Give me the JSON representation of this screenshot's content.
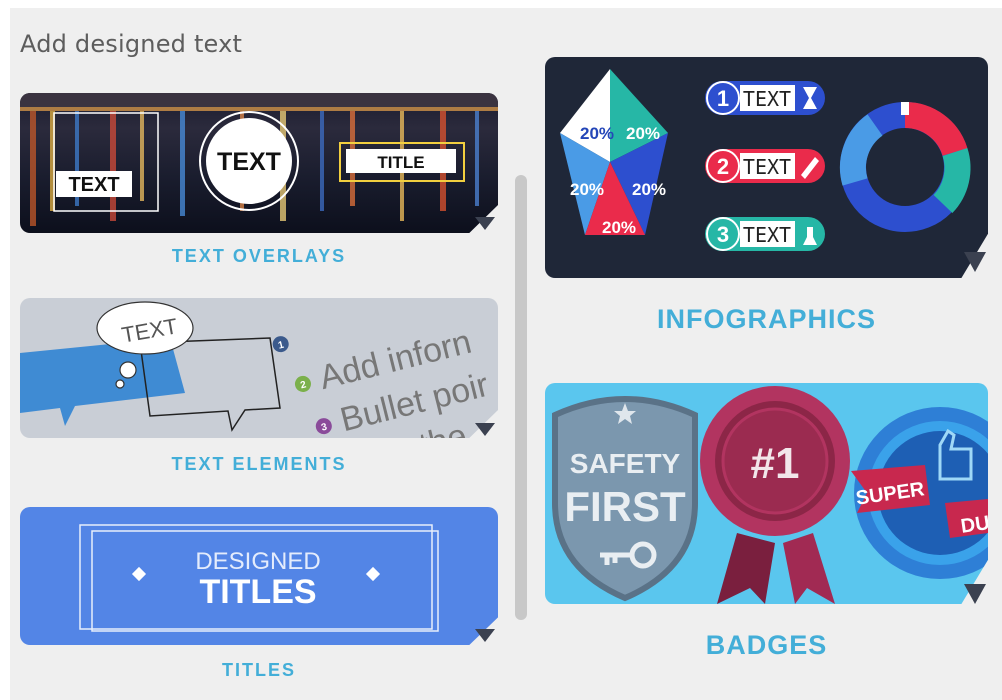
{
  "panel": {
    "heading": "Add designed text"
  },
  "cards": {
    "text_overlays": {
      "label": "TEXT OVERLAYS",
      "art": {
        "text_box": "TEXT",
        "text_circle": "TEXT",
        "title_box": "TITLE"
      }
    },
    "text_elements": {
      "label": "TEXT ELEMENTS",
      "art": {
        "bubble_text": "TEXT",
        "bullet_nums": [
          "1",
          "2",
          "3"
        ],
        "bullets": [
          "Add inforn",
          "Bullet poir",
          "Anothe"
        ]
      }
    },
    "titles": {
      "label": "TITLES",
      "art": {
        "line1": "DESIGNED",
        "line2": "TITLES"
      }
    },
    "infographics": {
      "label": "INFOGRAPHICS",
      "art": {
        "pentagon_values": [
          "20%",
          "20%",
          "20%",
          "20%",
          "20%"
        ],
        "steps": [
          {
            "num": "1",
            "text": "TEXT"
          },
          {
            "num": "2",
            "text": "TEXT"
          },
          {
            "num": "3",
            "text": "TEXT"
          }
        ]
      }
    },
    "badges": {
      "label": "BADGES",
      "art": {
        "shield_line1": "SAFETY",
        "shield_line2": "FIRST",
        "rosette": "#1",
        "ribbon": "SUPER",
        "ribbon_tail": "DU"
      }
    }
  },
  "colors": {
    "panel_bg": "#efefef",
    "label": "#43aed8",
    "caret": "#3b4150",
    "titles_bg": "#5385e6",
    "info_bg": "#1f2738",
    "badges_bg": "#5ac6ee"
  }
}
